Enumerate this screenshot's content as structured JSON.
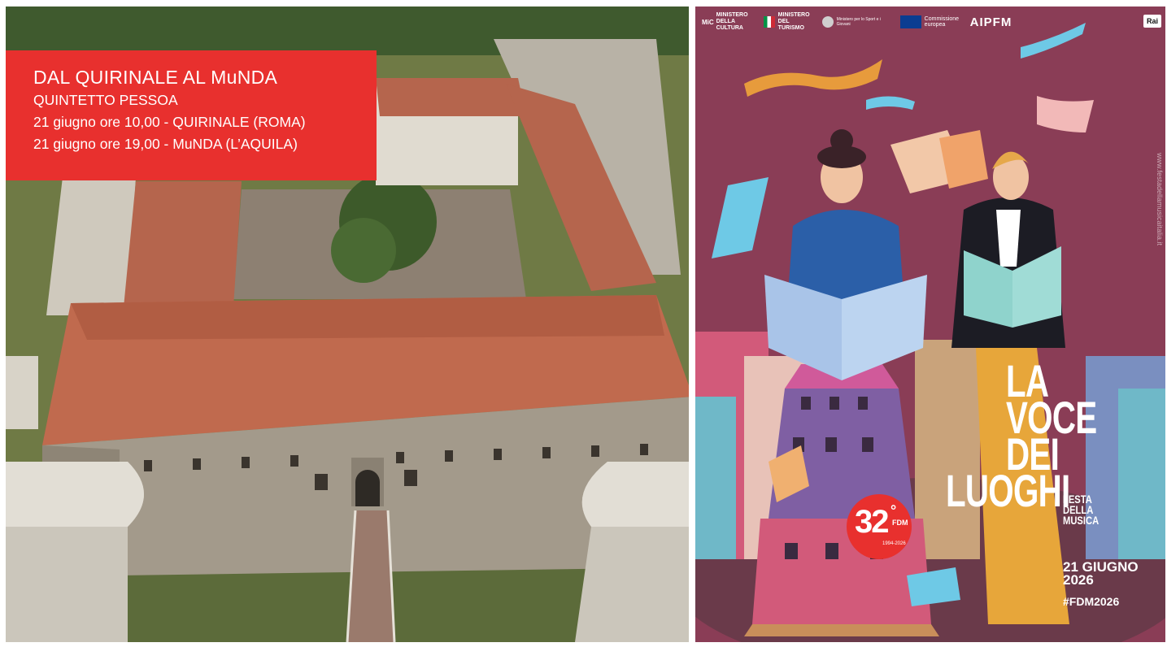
{
  "event": {
    "title": "DAL QUIRINALE AL MuNDA",
    "subtitle": "QUINTETTO PESSOA",
    "line1": "21 giugno ore 10,00 - QUIRINALE (ROMA)",
    "line2": "21 giugno ore 19,00 - MuNDA (L’AQUILA)"
  },
  "poster": {
    "logos": {
      "mic": "MINISTERO DELLA CULTURA",
      "mic_short": "MiC",
      "turismo": "MINISTERO DEL TURISMO",
      "sport": "Ministero per lo Sport e i Giovani",
      "ue": "Commissione europea",
      "aipfm": "AIPFM",
      "rai": "Rai"
    },
    "side_url": "www.festadellamusicaitalia.it",
    "title_lines": [
      "LA",
      "VOCE",
      "DEI",
      "LUOGHI"
    ],
    "festa_lines": [
      "FESTA",
      "DELLA",
      "MUSICA"
    ],
    "date_lines": [
      "21 GIUGNO",
      "2026"
    ],
    "hashtag": "#FDM2026",
    "badge": {
      "num": "32",
      "sup": "°",
      "fdm": "FDM",
      "years": "1994-2026"
    },
    "book_text": "FESTA DELLA MUSICA"
  },
  "colors": {
    "red": "#e8302e",
    "poster_bg": "#8a3d56",
    "roof": "#b5654d"
  }
}
